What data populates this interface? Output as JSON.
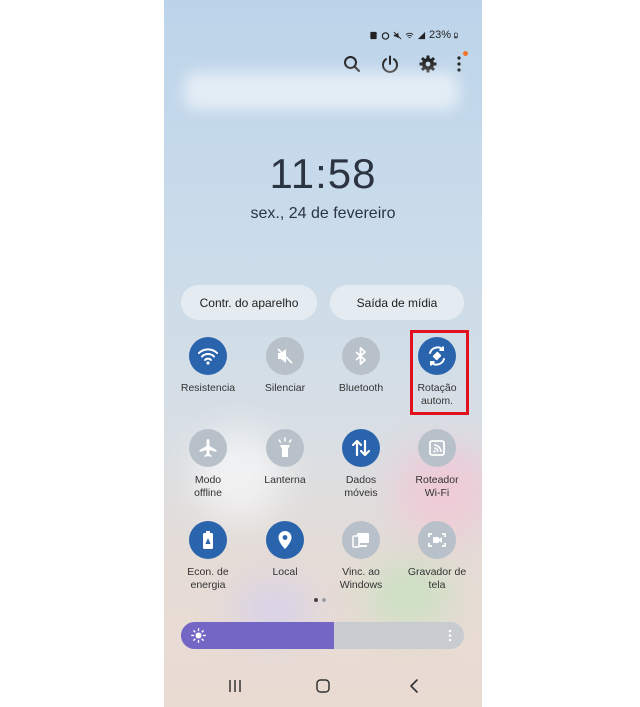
{
  "status_bar": {
    "battery_label": "23%",
    "icons": [
      "sim-icon",
      "alarm-icon",
      "mute-icon",
      "wifi-icon",
      "signal-icon",
      "battery-icon"
    ]
  },
  "header_icons": [
    "search-icon",
    "power-icon",
    "settings-icon",
    "more-icon"
  ],
  "clock": {
    "time": "11:58",
    "date": "sex., 24 de fevereiro"
  },
  "pills": {
    "device_control": "Contr. do aparelho",
    "media_output": "Saída de mídia"
  },
  "tiles": [
    {
      "label": "Resistencia",
      "state": "on",
      "icon": "wifi-icon"
    },
    {
      "label": "Silenciar",
      "state": "off",
      "icon": "mute-icon"
    },
    {
      "label": "Bluetooth",
      "state": "off",
      "icon": "bluetooth-icon"
    },
    {
      "label": "Rotação\nautom.",
      "state": "on",
      "icon": "auto-rotate-icon"
    },
    {
      "label": "Modo\noffline",
      "state": "off",
      "icon": "airplane-icon"
    },
    {
      "label": "Lanterna",
      "state": "off",
      "icon": "flashlight-icon"
    },
    {
      "label": "Dados\nmóveis",
      "state": "on",
      "icon": "mobile-data-icon"
    },
    {
      "label": "Roteador\nWi-Fi",
      "state": "off",
      "icon": "hotspot-icon"
    },
    {
      "label": "Econ. de\nenergia",
      "state": "on",
      "icon": "power-saving-icon"
    },
    {
      "label": "Local",
      "state": "on",
      "icon": "location-icon"
    },
    {
      "label": "Vinc. ao\nWindows",
      "state": "off",
      "icon": "link-windows-icon"
    },
    {
      "label": "Gravador de\ntela",
      "state": "off",
      "icon": "screen-recorder-icon"
    }
  ],
  "pager": {
    "pages": 2,
    "current": 1
  },
  "brightness": {
    "level": 0.54
  },
  "nav_bar": [
    "recents-icon",
    "home-icon",
    "back-icon"
  ],
  "colors": {
    "tile_on": "#2a64ad",
    "tile_off": "#b8c1c9",
    "brightness_fill": "#7466c4",
    "highlight": "#e1111d"
  }
}
